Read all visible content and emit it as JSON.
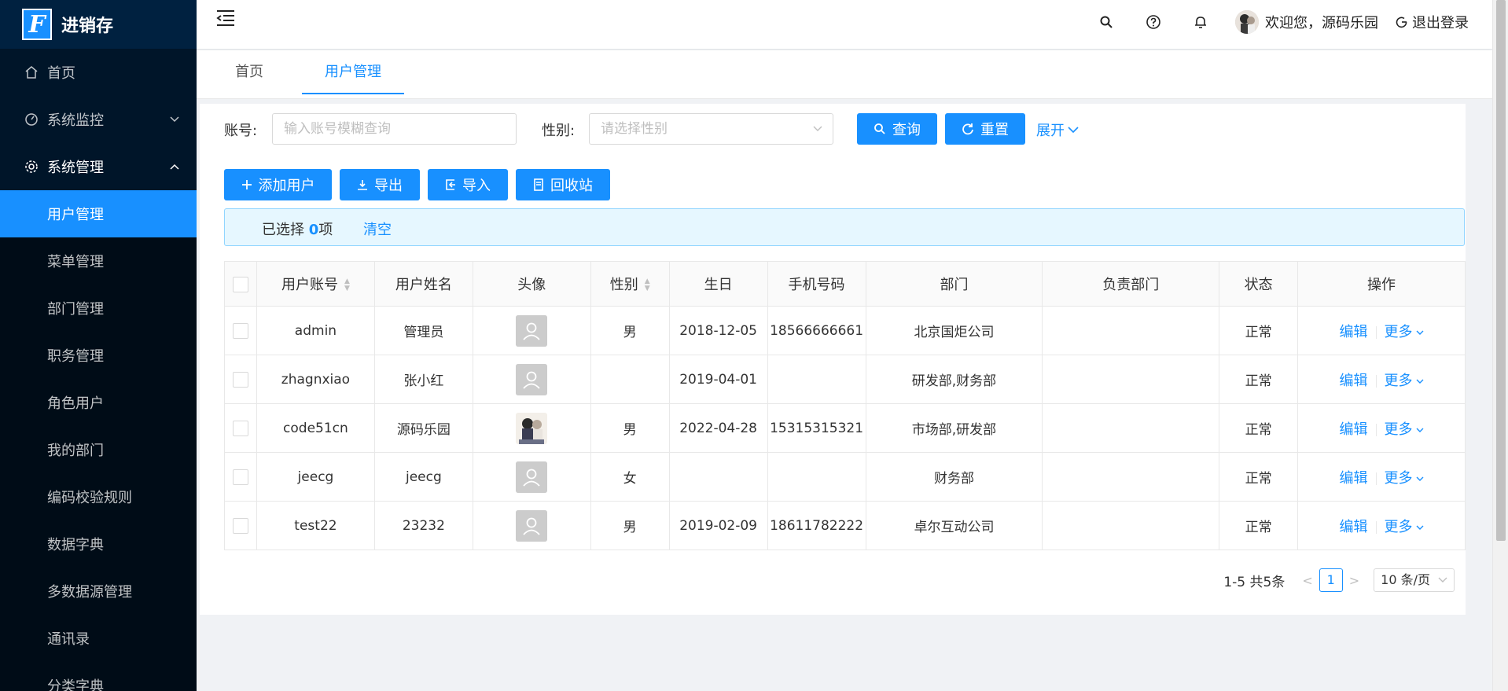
{
  "app": {
    "logo_letter": "F",
    "name": "进销存"
  },
  "sidebar": {
    "items": [
      {
        "label": "首页",
        "icon": "home-icon"
      },
      {
        "label": "系统监控",
        "icon": "dashboard-icon"
      },
      {
        "label": "系统管理",
        "icon": "setting-icon"
      }
    ],
    "sub_items": [
      {
        "label": "用户管理"
      },
      {
        "label": "菜单管理"
      },
      {
        "label": "部门管理"
      },
      {
        "label": "职务管理"
      },
      {
        "label": "角色用户"
      },
      {
        "label": "我的部门"
      },
      {
        "label": "编码校验规则"
      },
      {
        "label": "数据字典"
      },
      {
        "label": "多数据源管理"
      },
      {
        "label": "通讯录"
      },
      {
        "label": "分类字典"
      }
    ]
  },
  "header": {
    "welcome": "欢迎您，源码乐园",
    "logout": "退出登录"
  },
  "tabs": [
    {
      "label": "首页"
    },
    {
      "label": "用户管理"
    }
  ],
  "search": {
    "account_label": "账号:",
    "account_placeholder": "输入账号模糊查询",
    "gender_label": "性别:",
    "gender_placeholder": "请选择性别",
    "query_button": "查询",
    "reset_button": "重置",
    "expand_link": "展开"
  },
  "toolbar": {
    "add_user": "添加用户",
    "export": "导出",
    "import": "导入",
    "recycle": "回收站"
  },
  "selection": {
    "prefix": "已选择 ",
    "count": "0",
    "suffix": "项",
    "clear": "清空"
  },
  "table": {
    "columns": [
      "用户账号",
      "用户姓名",
      "头像",
      "性别",
      "生日",
      "手机号码",
      "部门",
      "负责部门",
      "状态",
      "操作"
    ],
    "rows": [
      {
        "account": "admin",
        "name": "管理员",
        "avatar": "placeholder",
        "gender": "男",
        "birthday": "2018-12-05",
        "phone": "18566666661",
        "dept": "北京国炬公司",
        "manage_dept": "",
        "status": "正常"
      },
      {
        "account": "zhagnxiao",
        "name": "张小红",
        "avatar": "placeholder",
        "gender": "",
        "birthday": "2019-04-01",
        "phone": "",
        "dept": "研发部,财务部",
        "manage_dept": "",
        "status": "正常"
      },
      {
        "account": "code51cn",
        "name": "源码乐园",
        "avatar": "photo",
        "gender": "男",
        "birthday": "2022-04-28",
        "phone": "15315315321",
        "dept": "市场部,研发部",
        "manage_dept": "",
        "status": "正常"
      },
      {
        "account": "jeecg",
        "name": "jeecg",
        "avatar": "placeholder",
        "gender": "女",
        "birthday": "",
        "phone": "",
        "dept": "财务部",
        "manage_dept": "",
        "status": "正常"
      },
      {
        "account": "test22",
        "name": "23232",
        "avatar": "placeholder",
        "gender": "男",
        "birthday": "2019-02-09",
        "phone": "18611782222",
        "dept": "卓尔互动公司",
        "manage_dept": "",
        "status": "正常"
      }
    ],
    "edit_label": "编辑",
    "more_label": "更多"
  },
  "pagination": {
    "total": "1-5 共5条",
    "current": "1",
    "page_size": "10 条/页"
  },
  "colors": {
    "primary": "#1890ff",
    "sidebar_bg": "#001529"
  }
}
